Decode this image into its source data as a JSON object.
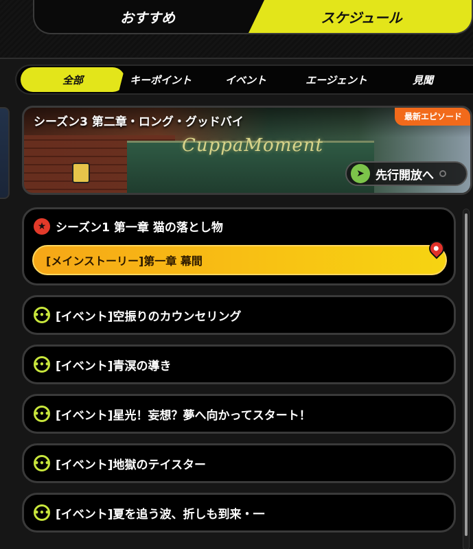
{
  "top_tabs": {
    "recommend": "おすすめ",
    "schedule": "スケジュール",
    "active": "schedule"
  },
  "filters": {
    "all": "全部",
    "key_points": "キーポイント",
    "event": "イベント",
    "agent": "エージェント",
    "sightseeing": "見聞",
    "active": "all"
  },
  "banner": {
    "title": "シーズン3 第二章・ロング・グッドバイ",
    "badge": "最新エピソード",
    "sign_text": "CuppaMoment",
    "early_access_label": "先行開放へ"
  },
  "main_entry": {
    "season_title": "シーズン1 第一章 猫の落とし物",
    "current_item": "[メインストーリー]第一章 幕間"
  },
  "events": [
    "[イベント]空振りのカウンセリング",
    "[イベント]青溟の導き",
    "[イベント]星光！妄想？夢へ向かってスタート！",
    "[イベント]地獄のテイスター",
    "[イベント]夏を追う波、折しも到来・一"
  ],
  "colors": {
    "accent_yellow": "#e3e51a",
    "badge_orange": "#f26a1b",
    "main_bar": "#f8c313",
    "event_icon": "#c8e63c",
    "season_icon": "#e23a2a"
  },
  "icons": {
    "season": "star-icon",
    "event": "more-icon",
    "pin": "pin-icon",
    "early_access": "send-icon"
  }
}
